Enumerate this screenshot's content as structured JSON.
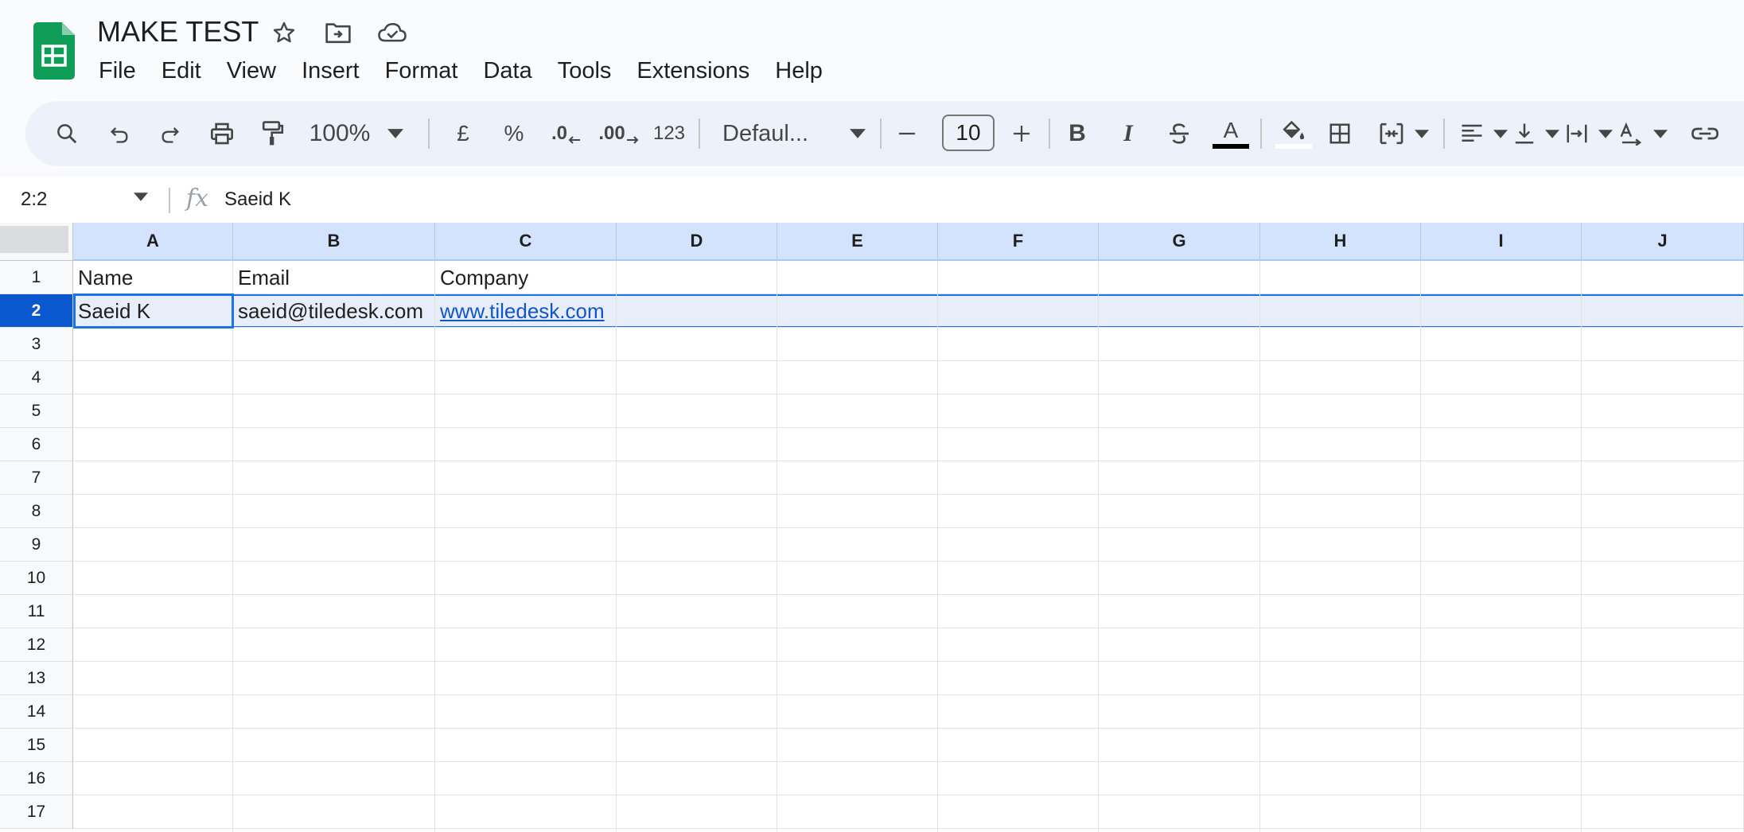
{
  "app": {
    "title": "MAKE TEST",
    "brand_color": "#0f9d58"
  },
  "menu": [
    "File",
    "Edit",
    "View",
    "Insert",
    "Format",
    "Data",
    "Tools",
    "Extensions",
    "Help"
  ],
  "toolbar": {
    "zoom": "100%",
    "currency_label": "£",
    "percent_label": "%",
    "decrease_decimal_label": ".0",
    "increase_decimal_label": ".00",
    "number_format_label": "123",
    "font_family": "Defaul...",
    "font_size": "10",
    "bold_label": "B",
    "italic_label": "I",
    "text_color_label": "A",
    "icons": [
      "search-icon",
      "undo-icon",
      "redo-icon",
      "print-icon",
      "paint-format-icon",
      "text-color-icon",
      "fill-color-icon",
      "borders-icon",
      "merge-cells-icon",
      "horizontal-align-icon",
      "vertical-align-icon",
      "text-wrap-icon",
      "text-rotation-icon",
      "insert-link-icon"
    ]
  },
  "formula_bar": {
    "name_box": "2:2",
    "fx_label": "fx",
    "content": "Saeid K"
  },
  "grid": {
    "columns": [
      "A",
      "B",
      "C",
      "D",
      "E",
      "F",
      "G",
      "H",
      "I",
      "J"
    ],
    "row_numbers": [
      "1",
      "2",
      "3",
      "4",
      "5",
      "6",
      "7",
      "8",
      "9",
      "10",
      "11",
      "12",
      "13",
      "14",
      "15",
      "16",
      "17"
    ],
    "selected_row": "2",
    "active_cell": "A2",
    "rows": [
      [
        "Name",
        "Email",
        "Company"
      ],
      [
        "Saeid K",
        "saeid@tiledesk.com",
        "www.tiledesk.com"
      ]
    ],
    "link_color": "#1155cc",
    "selection_color": "#1a73e8"
  }
}
